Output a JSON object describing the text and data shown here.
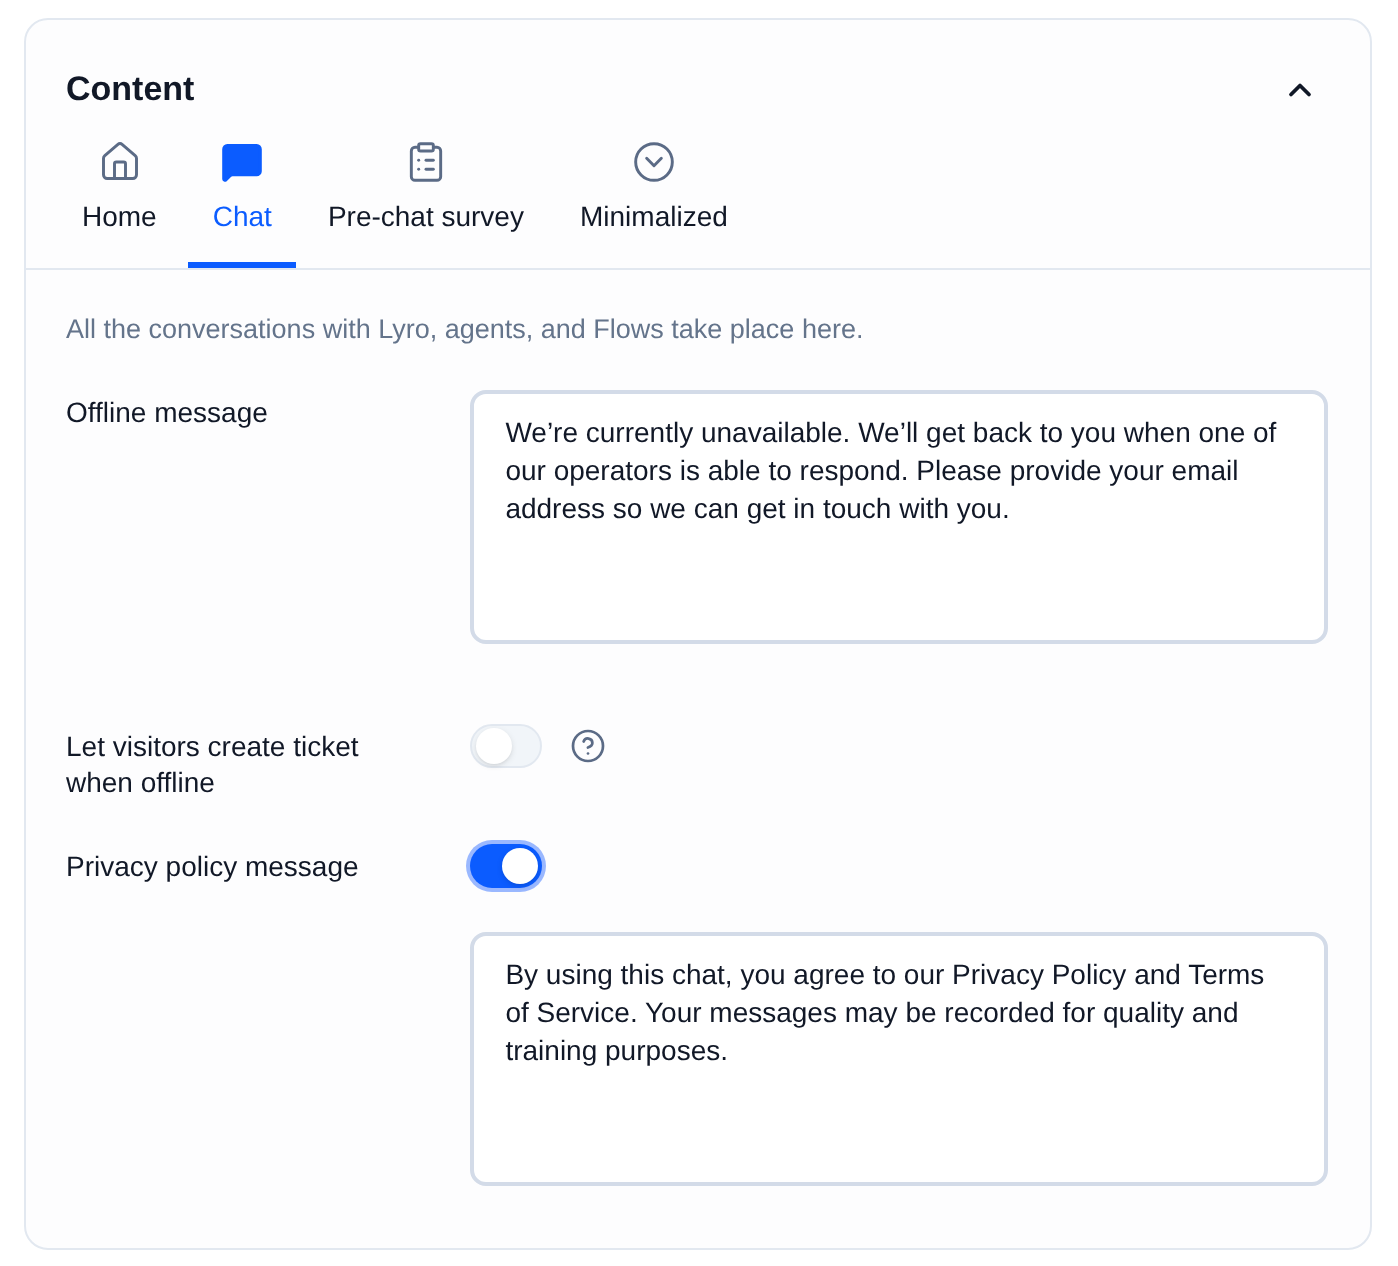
{
  "panel": {
    "title": "Content",
    "expanded": true
  },
  "tabs": [
    {
      "label": "Home",
      "selected": false
    },
    {
      "label": "Chat",
      "selected": true
    },
    {
      "label": "Pre-chat survey",
      "selected": false
    },
    {
      "label": "Minimalized",
      "selected": false
    }
  ],
  "description": "All the conversations with Lyro, agents, and Flows take place here.",
  "fields": [
    {
      "kind": "textarea",
      "label": "Offline message",
      "value": "We’re currently unavailable. We’ll get back to you when one of our operators is able to respond. Please provide your email address so we can get in touch with you."
    },
    {
      "kind": "toggle",
      "label": "Let visitors create ticket when offline",
      "on": false,
      "help": true
    },
    {
      "kind": "toggle",
      "label": "Privacy policy message",
      "on": true
    },
    {
      "kind": "textarea",
      "value": "By using this chat, you agree to our Privacy Policy and Terms of Service. Your messages may be recorded for quality and training purposes."
    }
  ]
}
